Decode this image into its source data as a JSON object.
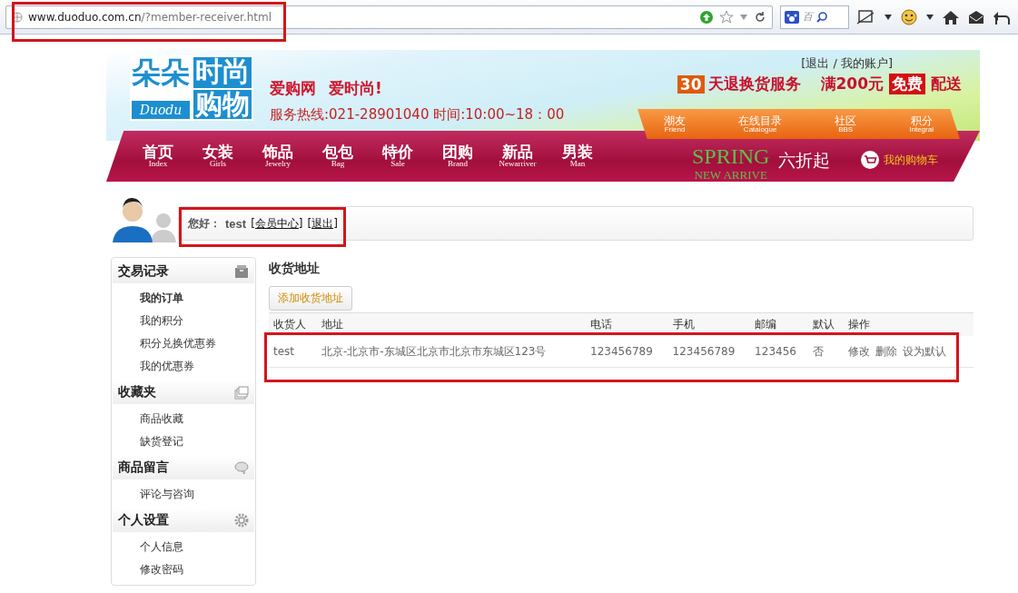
{
  "browser": {
    "url_host": "www.duoduo.com.cn",
    "url_path": "/?member-receiver.html",
    "search_placeholder": "百"
  },
  "banner": {
    "logo": {
      "top_left": "朵朵",
      "top_right": "时尚",
      "script": "Duodu",
      "bottom_right": "购物"
    },
    "slogans": [
      "爱购网",
      "爱时尚!"
    ],
    "hotline": "服务热线:021-28901040 时间:10:00~18：00",
    "account_links": "[退出 / 我的账户]",
    "promo": {
      "days": "30",
      "days_text": "天退换货服务",
      "threshold": "满200元",
      "free": "免费",
      "delivery": "配送"
    },
    "subnav": [
      {
        "label": "潮友",
        "sub": "Friend"
      },
      {
        "label": "在线目录",
        "sub": "Catalogue"
      },
      {
        "label": "社区",
        "sub": "BBS"
      },
      {
        "label": "积分",
        "sub": "Integral"
      }
    ],
    "nav": [
      {
        "label": "首页",
        "sub": "Index"
      },
      {
        "label": "女装",
        "sub": "Girls"
      },
      {
        "label": "饰品",
        "sub": "Jewelry"
      },
      {
        "label": "包包",
        "sub": "Bag"
      },
      {
        "label": "特价",
        "sub": "Sale"
      },
      {
        "label": "团购",
        "sub": "Brand"
      },
      {
        "label": "新品",
        "sub": "Newarriver"
      },
      {
        "label": "男装",
        "sub": "Man"
      }
    ],
    "spring": {
      "title": "SPRING",
      "subtitle": "NEW ARRIVE",
      "discount": "六折起"
    },
    "cart": "我的购物车"
  },
  "user_bar": {
    "greeting": "您好：",
    "username": "test",
    "links": [
      "[会员中心]",
      "[退出]"
    ]
  },
  "sidebar": [
    {
      "title": "交易记录",
      "kind": "box",
      "items": [
        {
          "label": "我的订单",
          "selected": true
        },
        {
          "label": "我的积分",
          "selected": false
        },
        {
          "label": "积分兑换优惠券",
          "selected": false
        },
        {
          "label": "我的优惠券",
          "selected": false
        }
      ]
    },
    {
      "title": "收藏夹",
      "kind": "windows",
      "items": [
        {
          "label": "商品收藏",
          "selected": false
        },
        {
          "label": "缺货登记",
          "selected": false
        }
      ]
    },
    {
      "title": "商品留言",
      "kind": "chat",
      "items": [
        {
          "label": "评论与咨询",
          "selected": false
        }
      ]
    },
    {
      "title": "个人设置",
      "kind": "gear",
      "items": [
        {
          "label": "个人信息",
          "selected": false
        },
        {
          "label": "修改密码",
          "selected": false
        }
      ]
    }
  ],
  "content": {
    "title": "收货地址",
    "add_button": "添加收货地址",
    "table": {
      "columns": [
        "收货人",
        "地址",
        "电话",
        "手机",
        "邮编",
        "默认",
        "操作"
      ],
      "rows": [
        {
          "receiver": "test",
          "address": "北京-北京市-东城区北京市北京市东城区123号",
          "phone": "123456789",
          "mobile": "123456789",
          "zip": "123456",
          "default": "否",
          "actions": [
            "修改",
            "删除",
            "设为默认"
          ]
        }
      ]
    }
  }
}
